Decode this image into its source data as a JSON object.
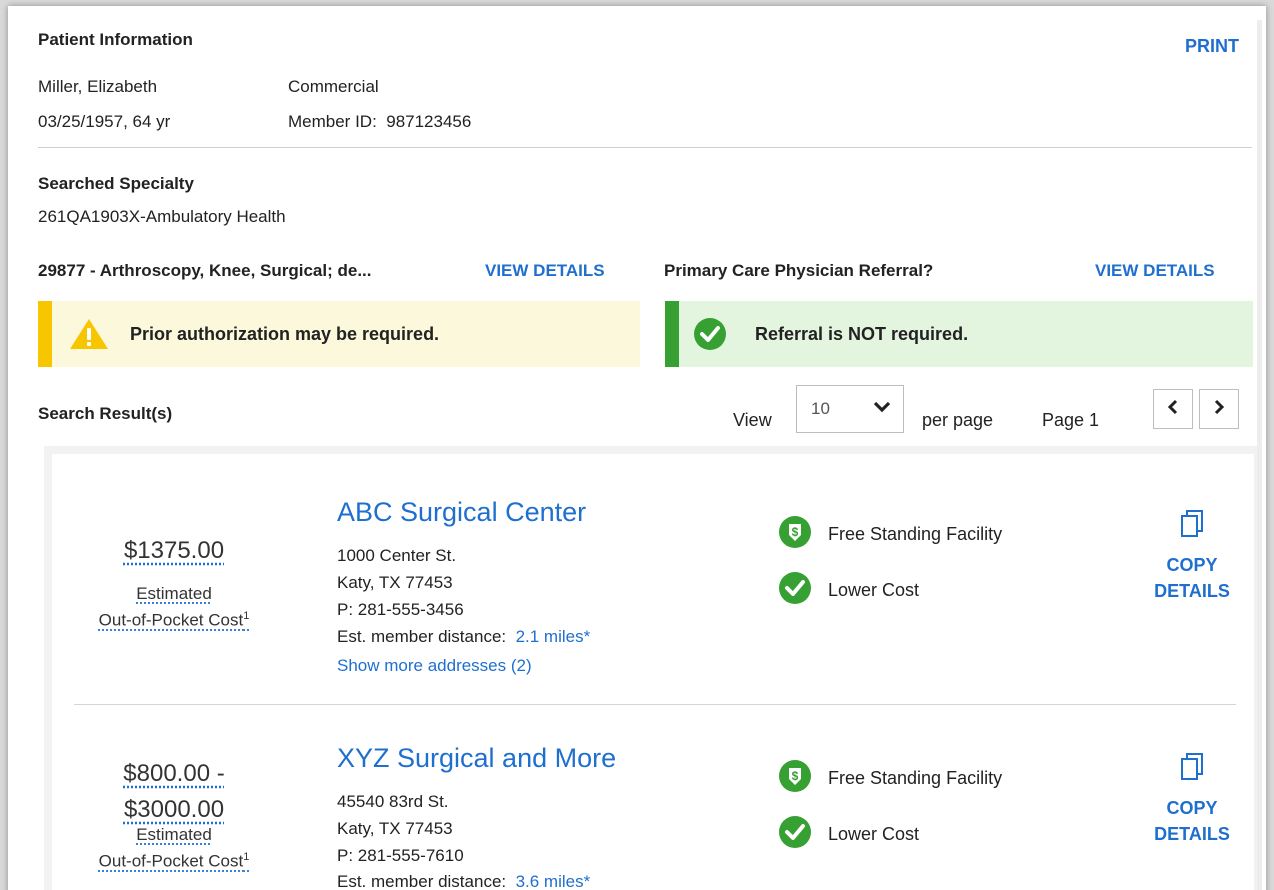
{
  "patient": {
    "heading": "Patient Information",
    "print_label": "PRINT",
    "name": "Miller, Elizabeth",
    "dob_age": "03/25/1957, 64 yr",
    "plan": "Commercial",
    "member_id": "Member ID:  987123456"
  },
  "specialty": {
    "heading": "Searched Specialty",
    "value": "261QA1903X-Ambulatory Health"
  },
  "procedure": {
    "title": "29877 - Arthroscopy, Knee, Surgical; de...",
    "view_details": "VIEW DETAILS",
    "alert": "Prior authorization may be required."
  },
  "referral": {
    "title": "Primary Care Physician Referral?",
    "view_details": "VIEW DETAILS",
    "alert": "Referral is NOT required."
  },
  "results_bar": {
    "heading": "Search Result(s)",
    "view_label": "View",
    "per_page_value": "10",
    "per_page_label": "per page",
    "page_label": "Page 1"
  },
  "results": [
    {
      "price": "$1375.00",
      "price_line2": "",
      "cost_label_1": "Estimated",
      "cost_label_2": "Out-of-Pocket Cost",
      "cost_sup": "1",
      "name": "ABC Surgical Center",
      "address": "1000 Center St.",
      "city": "Katy, TX 77453",
      "phone": "P: 281-555-3456",
      "distance_label": "Est. member distance:",
      "distance_value": "2.1 miles*",
      "more_addresses": "Show more addresses (2)",
      "badge1": "Free Standing Facility",
      "badge2": "Lower Cost",
      "copy_1": "COPY",
      "copy_2": "DETAILS"
    },
    {
      "price": "$800.00 -",
      "price_line2": "$3000.00",
      "cost_label_1": "Estimated",
      "cost_label_2": "Out-of-Pocket Cost",
      "cost_sup": "1",
      "name": "XYZ Surgical and More",
      "address": "45540 83rd St.",
      "city": "Katy, TX 77453",
      "phone": "P: 281-555-7610",
      "distance_label": "Est. member distance:",
      "distance_value": "3.6 miles*",
      "badge1": "Free Standing Facility",
      "badge2": "Lower Cost",
      "copy_1": "COPY",
      "copy_2": "DETAILS"
    }
  ],
  "colors": {
    "link": "#1f6fcf",
    "warning": "#f7c600",
    "success": "#37a033"
  },
  "icons": [
    "warning-icon",
    "check-circle-icon",
    "chevron-down-icon",
    "chevron-left-icon",
    "chevron-right-icon",
    "dollar-down-icon",
    "copy-icon"
  ]
}
